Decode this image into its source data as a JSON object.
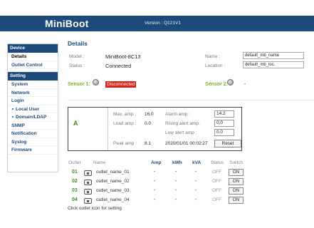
{
  "header": {
    "brand": "MiniBoot",
    "version": "Version : Q121V1"
  },
  "sidebar": {
    "device_heading": "Device",
    "device_items": [
      {
        "label": "Details",
        "active": true
      },
      {
        "label": "Outlet Control"
      }
    ],
    "setting_heading": "Setting",
    "setting_items": [
      {
        "label": "System"
      },
      {
        "label": "Network"
      },
      {
        "label": "Login"
      },
      {
        "label": "Local User",
        "sub": true
      },
      {
        "label": "Domain/LDAP",
        "sub": true
      },
      {
        "label": "SNMP"
      },
      {
        "label": "Notification"
      },
      {
        "label": "Syslog"
      },
      {
        "label": "Firmware"
      }
    ]
  },
  "details": {
    "title": "Details",
    "model_label": "Model :",
    "model_value": "MiniBoot-8C13",
    "status_label": "Status :",
    "status_value": "Connected",
    "name_label": "Name :",
    "name_value": "default_mb_name",
    "location_label": "Location :",
    "location_value": "default_mb_loc."
  },
  "sensors": {
    "sensor1_label": "Sensor 1:",
    "sensor1_status": "Disconnected",
    "sensor2_label": "Sensor 2:",
    "sensor2_value": "-"
  },
  "phase_panel": {
    "phase": "A",
    "max_amp_label": "Max. amp :",
    "max_amp_value": "16.0",
    "load_amp_label": "Load amp :",
    "load_amp_value": "0.0",
    "peak_amp_label": "Peak amp :",
    "peak_amp_value": "8.1",
    "alarm_amp_label": "Alarm amp :",
    "alarm_amp_value": "14.2",
    "rising_alert_label": "Rising alert amp :",
    "rising_alert_value": "0.0",
    "low_alert_label": "Low alert amp :",
    "low_alert_value": "0.0",
    "peak_time": "2020/01/01 00:02:27",
    "reset_label": "Reset"
  },
  "outlet_table": {
    "headers": {
      "outlet": "Outlet",
      "name": "Name",
      "amp": "Amp",
      "kwh": "kWh",
      "kva": "kVA",
      "status": "Status",
      "switch": "Switch"
    },
    "rows": [
      {
        "num": "01",
        "name": "outlet_name_01",
        "amp": "-",
        "kwh": "-",
        "kva": "-",
        "status": "OFF",
        "switch": "ON"
      },
      {
        "num": "02",
        "name": "outlet_name_02",
        "amp": "-",
        "kwh": "-",
        "kva": "-",
        "status": "OFF",
        "switch": "ON"
      },
      {
        "num": "03",
        "name": "outlet_name_03",
        "amp": "-",
        "kwh": "-",
        "kva": "-",
        "status": "OFF",
        "switch": "ON"
      },
      {
        "num": "04",
        "name": "outlet_name_04",
        "amp": "-",
        "kwh": "-",
        "kva": "-",
        "status": "OFF",
        "switch": "ON"
      }
    ],
    "note": "Click outlet icon for setting"
  },
  "colors": {
    "brand": "#1d4a7a",
    "accent_green": "#3c8b22",
    "sensor_green": "#7bb02f",
    "alert_red": "#d9251c"
  }
}
